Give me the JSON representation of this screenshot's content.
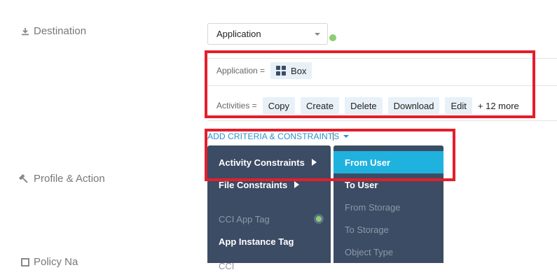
{
  "sections": {
    "destination": "Destination",
    "profile_action": "Profile & Action",
    "policy_name": "Policy Na"
  },
  "destination_select": {
    "value": "Application",
    "status_color": "#8ccf70"
  },
  "criteria": {
    "application": {
      "label": "Application =",
      "chip": {
        "icon": "grid-icon",
        "text": "Box"
      }
    },
    "activities": {
      "label": "Activities =",
      "chips": [
        "Copy",
        "Create",
        "Delete",
        "Download",
        "Edit"
      ],
      "more": "+ 12 more"
    }
  },
  "add_link": {
    "label_before_cursor": "ADD CRITERIA & CONSTRAINT",
    "label_after_cursor": "S"
  },
  "menu_left": {
    "items": [
      {
        "label": "Activity Constraints",
        "has_submenu": true,
        "disabled": false
      },
      {
        "label": "File Constraints",
        "has_submenu": true,
        "disabled": false
      },
      {
        "label": "CCI App Tag",
        "has_submenu": false,
        "disabled": true
      },
      {
        "label": "App Instance Tag",
        "has_submenu": false,
        "disabled": false
      },
      {
        "label": "CCI",
        "has_submenu": false,
        "disabled": true
      }
    ]
  },
  "menu_right": {
    "items": [
      {
        "label": "From User",
        "active": true,
        "disabled": false
      },
      {
        "label": "To User",
        "active": false,
        "disabled": false
      },
      {
        "label": "From Storage",
        "active": false,
        "disabled": true
      },
      {
        "label": "To Storage",
        "active": false,
        "disabled": true
      },
      {
        "label": "Object Type",
        "active": false,
        "disabled": true
      }
    ]
  },
  "colors": {
    "highlight_red": "#e41e2b",
    "menu_bg": "#3c4c64",
    "menu_active": "#1fb2de",
    "link_blue": "#2a8fd0",
    "chip_bg": "#e8f1f7"
  }
}
